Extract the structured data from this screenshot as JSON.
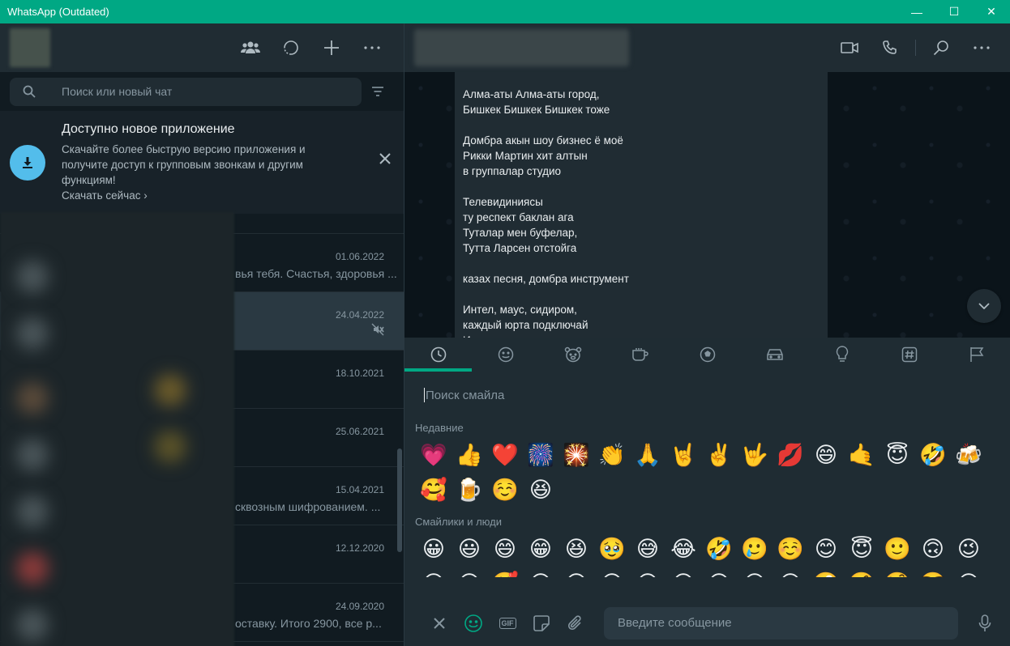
{
  "window": {
    "title": "WhatsApp (Outdated)",
    "minimize": "—",
    "maximize": "☐",
    "close": "✕"
  },
  "sidebar": {
    "search_placeholder": "Поиск или новый чат",
    "banner": {
      "title": "Доступно новое приложение",
      "desc": "Скачайте более быструю версию приложения и получите доступ к групповым звонкам и другим функциям!",
      "link": "Скачать сейчас ›"
    },
    "chats": [
      {
        "date": "01.06.2022",
        "preview": "вья тебя. Счастья, здоровья ..."
      },
      {
        "date": "24.04.2022",
        "preview": "",
        "muted": true
      },
      {
        "date": "18.10.2021",
        "preview": ""
      },
      {
        "date": "25.06.2021",
        "preview": ""
      },
      {
        "date": "15.04.2021",
        "preview": "сквозным шифрованием. ..."
      },
      {
        "date": "12.12.2020",
        "preview": ""
      },
      {
        "date": "24.09.2020",
        "preview": "оставку. Итого 2900, все р..."
      }
    ]
  },
  "conversation": {
    "lines": [
      "Алма-аты Алма-аты город,",
      "Бишкек Бишкек Бишкек тоже",
      "",
      "Домбра акын шоу бизнес ё моё",
      "Рикки Мартин хит алтын",
      "в группалар студио",
      "",
      "Телевидиниясы",
      "ту респект баклан ага",
      "Туталар мен буфелар,",
      "Тутта Ларсен отстойга",
      "",
      "казах песня, домбра инструмент",
      "",
      "Интел, маус, сидиром,",
      "каждый юрта подключай",
      "И"
    ]
  },
  "emoji_panel": {
    "search_placeholder": "Поиск смайла",
    "recent_label": "Недавние",
    "smileys_label": "Смайлики и люди",
    "recent": [
      "💗",
      "👍",
      "❤️",
      "🎆",
      "🎇",
      "👏",
      "🙏",
      "🤘",
      "✌️",
      "🤟",
      "💋",
      "😄",
      "🤙",
      "😇",
      "🤣",
      "🍻",
      "🥰",
      "🍺",
      "☺️",
      "😆"
    ],
    "smileys": [
      "😀",
      "😃",
      "😄",
      "😁",
      "😆",
      "🥹",
      "😅",
      "😂",
      "🤣",
      "🥲",
      "☺️",
      "😊",
      "😇",
      "🙂",
      "🙃",
      "😉",
      "😌",
      "😍",
      "🥰",
      "😘",
      "😗",
      "😙",
      "😚",
      "😋",
      "😛",
      "😝",
      "😜",
      "🤪",
      "🤨",
      "🧐",
      "🤓",
      "😎"
    ]
  },
  "composer": {
    "placeholder": "Введите сообщение",
    "gif_label": "GIF"
  }
}
